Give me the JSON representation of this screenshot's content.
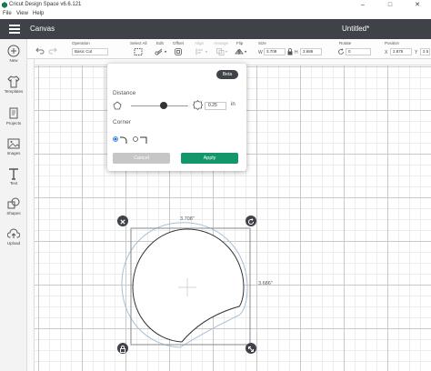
{
  "window": {
    "title": "Cricut Design Space  v6.6.121",
    "minimize": "–",
    "maximize": "□",
    "close": "✕"
  },
  "menu": {
    "file": "File",
    "view": "View",
    "help": "Help"
  },
  "header": {
    "section": "Canvas",
    "document_title": "Untitled*"
  },
  "toolbar": {
    "undo_icon": "undo-icon",
    "redo_icon": "redo-icon",
    "operation_label": "Operation",
    "operation_value": "Basic Cut",
    "select_all_label": "Select All",
    "edit_label": "Edit",
    "offset_label": "Offset",
    "align_label": "Align",
    "arrange_label": "Arrange",
    "flip_label": "Flip",
    "size_label": "Size",
    "size_w_prefix": "W",
    "size_w_value": "3.708",
    "size_h_prefix": "H",
    "size_h_value": "3.686",
    "rotate_label": "Rotate",
    "rotate_value": "0",
    "position_label": "Position",
    "pos_x_prefix": "X",
    "pos_x_value": "2.875",
    "pos_y_prefix": "Y",
    "pos_y_value": "2.5"
  },
  "sidebar": {
    "items": [
      {
        "label": "New",
        "icon": "plus-icon"
      },
      {
        "label": "Templates",
        "icon": "shirt-icon"
      },
      {
        "label": "Projects",
        "icon": "projects-icon"
      },
      {
        "label": "Images",
        "icon": "image-icon"
      },
      {
        "label": "Text",
        "icon": "text-icon"
      },
      {
        "label": "Shapes",
        "icon": "shapes-icon"
      },
      {
        "label": "Upload",
        "icon": "upload-icon"
      }
    ]
  },
  "offset_panel": {
    "badge": "Beta",
    "distance_label": "Distance",
    "distance_value": "0.25",
    "distance_unit": "in",
    "corner_label": "Corner",
    "cancel_label": "Cancel",
    "apply_label": "Apply"
  },
  "selection": {
    "width_label": "3.708\"",
    "height_label": "3.686\""
  },
  "colors": {
    "topbar": "#3f4248",
    "apply": "#12966a",
    "cancel": "#c6c6c6",
    "offset_outline": "#a9bfd6"
  }
}
